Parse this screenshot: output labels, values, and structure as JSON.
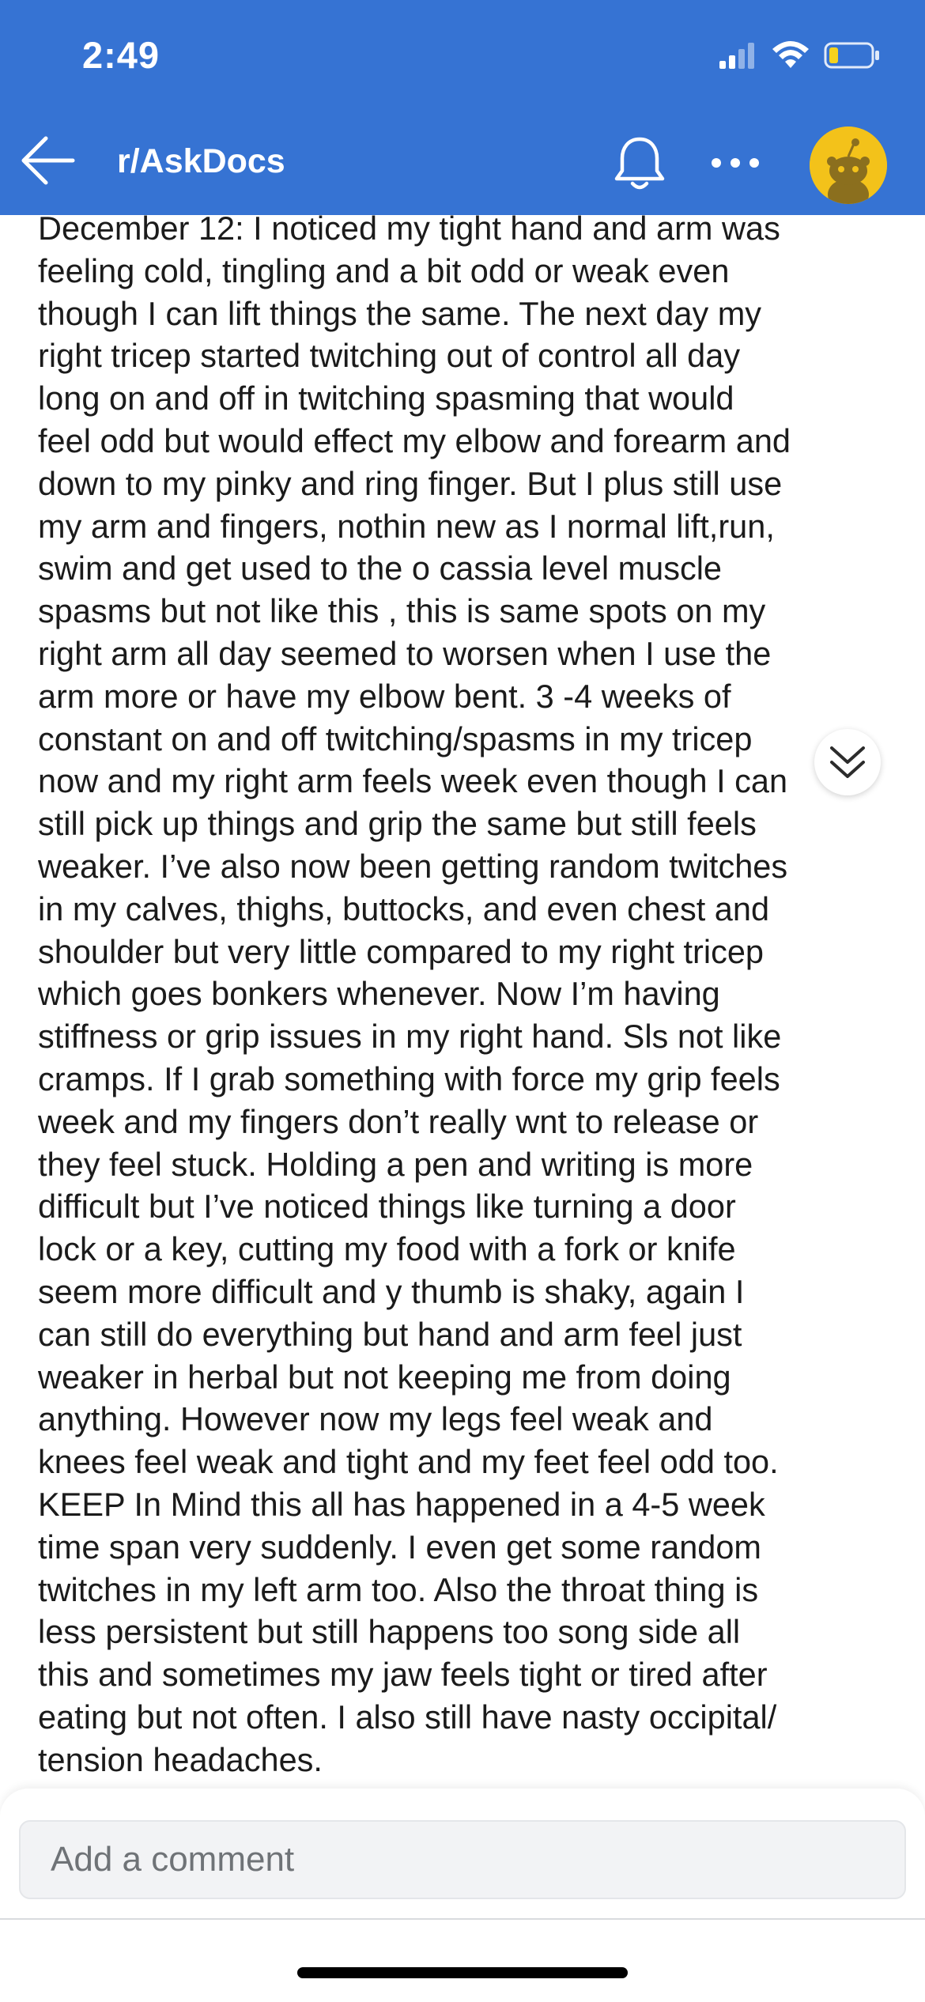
{
  "status_bar": {
    "time": "2:49",
    "icons": [
      "cellular-signal-icon",
      "wifi-icon",
      "battery-low-icon"
    ]
  },
  "nav": {
    "back_icon": "arrow-left-icon",
    "title": "r/AskDocs",
    "notification_icon": "bell-icon",
    "more_icon": "more-dots-icon",
    "avatar_icon": "reddit-avatar-icon"
  },
  "post": {
    "lines": [
      "December 12: I noticed my tight hand and arm was",
      "feeling cold,  tingling and a bit odd or weak even",
      "though I can lift things the same. The next day my",
      "right tricep started twitching out of control all day",
      "long on and off in twitching spasming that would",
      "feel odd but would effect my elbow and forearm and",
      "down to my pinky and ring finger. But I plus still use",
      "my arm and fingers, nothin new as I normal lift,run,",
      "swim and get used to the o cassia level muscle",
      "spasms but not like this , this is same spots on my",
      "right arm all day seemed to worsen when I use the",
      "arm more or have my elbow bent. 3 -4 weeks of",
      "constant on and off twitching/spasms in my tricep",
      "now and my right arm feels week even though I can",
      "still pick up things and grip the same but still feels",
      "weaker.  I’ve also now been getting random twitches",
      "in my calves, thighs, buttocks, and even chest and",
      "shoulder but very little compared to my right tricep",
      "which goes bonkers whenever. Now I’m having",
      "stiffness or grip issues  in my right hand. Sls not like",
      "cramps. If I grab something with force my grip feels",
      "week and my fingers don’t really wnt to release or",
      "they feel stuck. Holding a pen and writing is more",
      "difficult but I’ve noticed things like turning a door",
      "lock or a key,  cutting  my food with a fork or knife",
      "seem more difficult and y thumb is shaky, again I",
      "can still do everything but hand and arm feel just",
      "weaker in herbal but not keeping me from doing",
      "anything. However now my legs feel weak and",
      "knees feel weak and tight and my feet feel odd too.",
      "KEEP In Mind this all has happened in a 4-5 week",
      "time span very suddenly. I even get some random",
      "twitches in my left arm too. Also the throat thing is",
      "less persistent but still happens too song side all",
      "this and sometimes my jaw feels tight or tired after",
      "eating but not often. I also still have nasty occipital/",
      "tension headaches."
    ]
  },
  "scroll_button_icon": "chevron-double-down-icon",
  "comment": {
    "placeholder": "Add a comment"
  },
  "colors": {
    "header_bg": "#3673d3",
    "avatar_bg": "#f3c21a"
  }
}
